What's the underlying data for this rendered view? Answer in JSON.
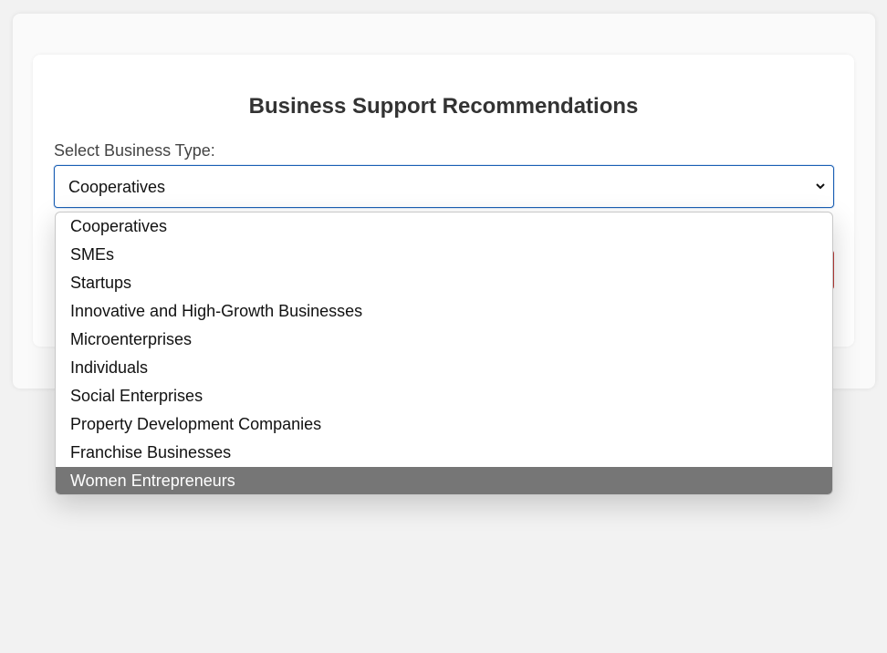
{
  "page": {
    "title": "Business Support Recommendations"
  },
  "form": {
    "label": "Select Business Type:",
    "selected_value": "Cooperatives",
    "options": [
      "Cooperatives",
      "SMEs",
      "Startups",
      "Innovative and High-Growth Businesses",
      "Microenterprises",
      "Individuals",
      "Social Enterprises",
      "Property Development Companies",
      "Franchise Businesses",
      "Women Entrepreneurs"
    ],
    "highlighted_option": "Women Entrepreneurs"
  },
  "colors": {
    "focus_border": "#1a5fb4",
    "highlight_background": "#767676",
    "button_partial": "#b83c38",
    "title_text": "#333333"
  },
  "icons": {
    "select_chevron": "chevron-down-icon"
  }
}
